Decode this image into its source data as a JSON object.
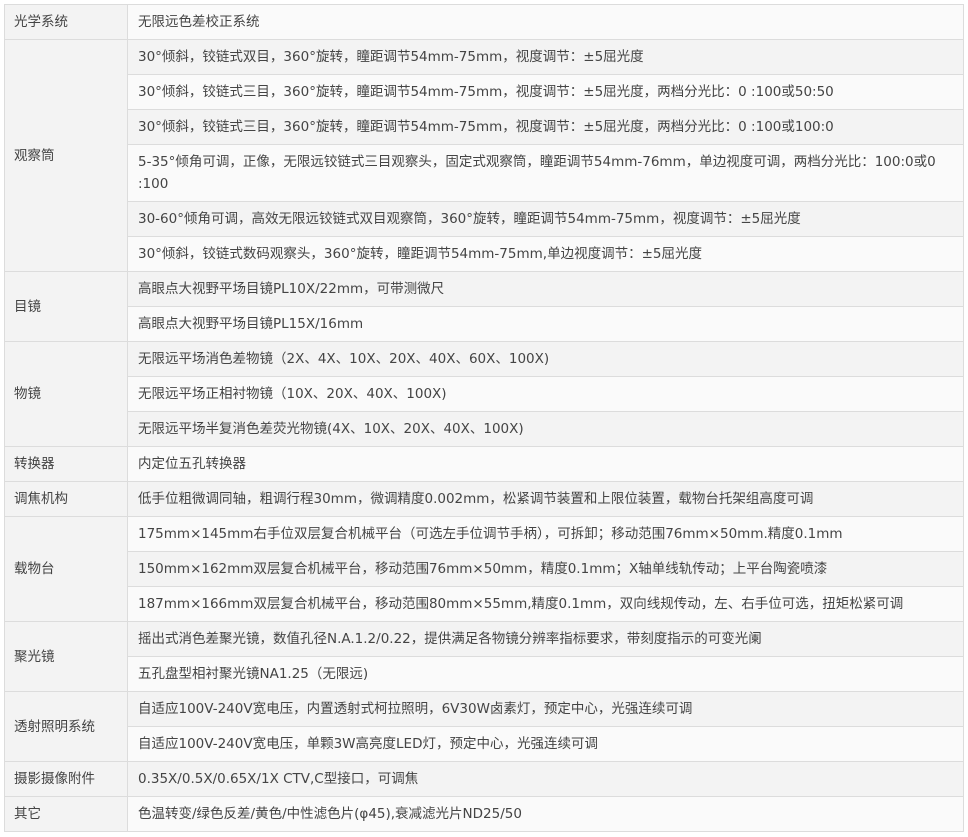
{
  "rows": [
    {
      "category": "光学系统",
      "values": [
        "无限远色差校正系统"
      ]
    },
    {
      "category": "观察筒",
      "values": [
        "30°倾斜，铰链式双目，360°旋转，瞳距调节54mm-75mm，视度调节：±5屈光度",
        "30°倾斜，铰链式三目，360°旋转，瞳距调节54mm-75mm，视度调节：±5屈光度，两档分光比：0 :100或50:50",
        "30°倾斜，铰链式三目，360°旋转，瞳距调节54mm-75mm，视度调节：±5屈光度，两档分光比：0 :100或100:0",
        "5-35°倾角可调，正像，无限远铰链式三目观察头，固定式观察筒，瞳距调节54mm-76mm，单边视度可调，两档分光比：100:0或0 :100",
        "30-60°倾角可调，高效无限远铰链式双目观察筒，360°旋转，瞳距调节54mm-75mm，视度调节：±5屈光度",
        "30°倾斜，铰链式数码观察头，360°旋转，瞳距调节54mm-75mm,单边视度调节：±5屈光度"
      ]
    },
    {
      "category": "目镜",
      "values": [
        "高眼点大视野平场目镜PL10X/22mm，可带测微尺",
        "高眼点大视野平场目镜PL15X/16mm"
      ]
    },
    {
      "category": "物镜",
      "values": [
        "无限远平场消色差物镜（2X、4X、10X、20X、40X、60X、100X)",
        "无限远平场正相衬物镜（10X、20X、40X、100X)",
        "无限远平场半复消色差荧光物镜(4X、10X、20X、40X、100X)"
      ]
    },
    {
      "category": "转换器",
      "values": [
        "内定位五孔转换器"
      ]
    },
    {
      "category": "调焦机构",
      "values": [
        "低手位粗微调同轴，粗调行程30mm，微调精度0.002mm，松紧调节装置和上限位装置，载物台托架组高度可调"
      ]
    },
    {
      "category": "载物台",
      "values": [
        "175mm×145mm右手位双层复合机械平台（可选左手位调节手柄），可拆卸；移动范围76mm×50mm.精度0.1mm",
        "150mm×162mm双层复合机械平台，移动范围76mm×50mm，精度0.1mm；X轴单线轨传动；上平台陶瓷喷漆",
        "187mm×166mm双层复合机械平台，移动范围80mm×55mm,精度0.1mm，双向线规传动，左、右手位可选，扭矩松紧可调"
      ]
    },
    {
      "category": "聚光镜",
      "values": [
        "摇出式消色差聚光镜，数值孔径N.A.1.2/0.22，提供满足各物镜分辨率指标要求，带刻度指示的可变光阑",
        "五孔盘型相衬聚光镜NA1.25（无限远)"
      ]
    },
    {
      "category": "透射照明系统",
      "values": [
        "自适应100V-240V宽电压，内置透射式柯拉照明，6V30W卤素灯，预定中心，光强连续可调",
        "自适应100V-240V宽电压，单颗3W高亮度LED灯，预定中心，光强连续可调"
      ]
    },
    {
      "category": "摄影摄像附件",
      "values": [
        "0.35X/0.5X/0.65X/1X CTV,C型接口，可调焦"
      ]
    },
    {
      "category": "其它",
      "values": [
        "色温转变/绿色反差/黄色/中性滤色片(φ45),衰减滤光片ND25/50"
      ]
    }
  ]
}
